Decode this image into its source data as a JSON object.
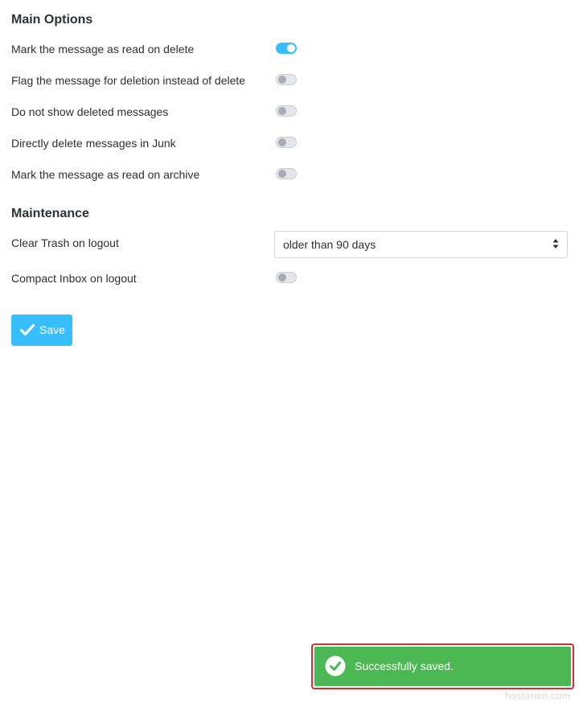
{
  "main_options": {
    "title": "Main Options",
    "rows": [
      {
        "label": "Mark the message as read on delete",
        "enabled": true
      },
      {
        "label": "Flag the message for deletion instead of delete",
        "enabled": false
      },
      {
        "label": "Do not show deleted messages",
        "enabled": false
      },
      {
        "label": "Directly delete messages in Junk",
        "enabled": false
      },
      {
        "label": "Mark the message as read on archive",
        "enabled": false
      }
    ]
  },
  "maintenance": {
    "title": "Maintenance",
    "clear_trash": {
      "label": "Clear Trash on logout",
      "selected": "older than 90 days"
    },
    "compact_inbox": {
      "label": "Compact Inbox on logout",
      "enabled": false
    }
  },
  "save_button": {
    "label": "Save",
    "icon": "check-icon"
  },
  "toast": {
    "message": "Successfully saved.",
    "icon": "check-circle-icon",
    "color": "#4cb853"
  },
  "watermark": "hostatom.com",
  "colors": {
    "accent": "#37beff",
    "success": "#4cb853",
    "highlight": "#d32f2f"
  }
}
